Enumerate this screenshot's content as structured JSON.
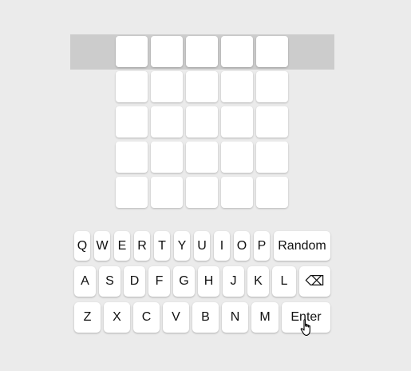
{
  "board": {
    "rows": 5,
    "cols": 5,
    "active_row": 0,
    "tiles": [
      [
        "",
        "",
        "",
        "",
        ""
      ],
      [
        "",
        "",
        "",
        "",
        ""
      ],
      [
        "",
        "",
        "",
        "",
        ""
      ],
      [
        "",
        "",
        "",
        "",
        ""
      ],
      [
        "",
        "",
        "",
        "",
        ""
      ]
    ]
  },
  "keyboard": {
    "row1": [
      "Q",
      "W",
      "E",
      "R",
      "T",
      "Y",
      "U",
      "I",
      "O",
      "P"
    ],
    "row1_action": "Random",
    "row2": [
      "A",
      "S",
      "D",
      "F",
      "G",
      "H",
      "J",
      "K",
      "L"
    ],
    "row2_action": "⌫",
    "row3": [
      "Z",
      "X",
      "C",
      "V",
      "B",
      "N",
      "M"
    ],
    "row3_action": "Enter"
  },
  "colors": {
    "background": "#ebebeb",
    "active_row_highlight": "#cccccc",
    "tile": "#ffffff",
    "key": "#ffffff"
  },
  "icons": {
    "cursor": "hand-pointer-icon",
    "backspace": "backspace-icon"
  }
}
